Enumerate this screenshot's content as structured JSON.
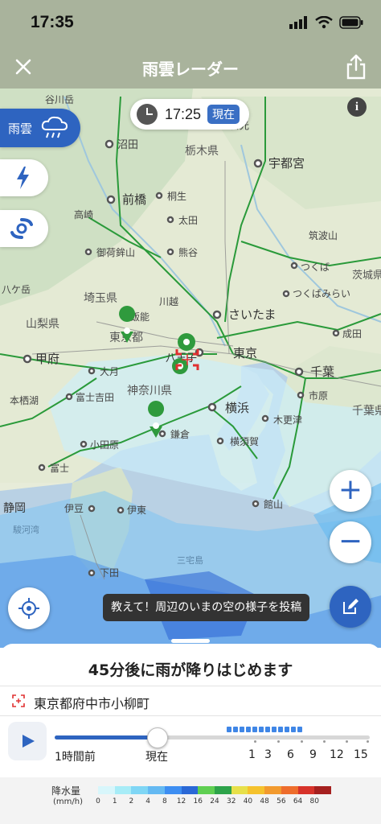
{
  "status_bar": {
    "time": "17:35"
  },
  "nav": {
    "title": "雨雲レーダー"
  },
  "map": {
    "time": "17:25",
    "now_badge": "現在",
    "layers": {
      "rain_label": "雨雲"
    },
    "place_labels": [
      "谷川岳",
      "日光",
      "沼田",
      "栃木県",
      "宇都宮",
      "前橋",
      "桐生",
      "高崎",
      "太田",
      "筑波山",
      "御荷鉾山",
      "熊谷",
      "つくば",
      "つくばみらい",
      "茨城県",
      "八ケ岳",
      "埼玉県",
      "川越",
      "飯能",
      "さいたま",
      "成田",
      "山梨県",
      "東京都",
      "甲府",
      "八王子",
      "東京",
      "千葉",
      "大月",
      "神奈川県",
      "市原",
      "本栖湖",
      "富士吉田",
      "横浜",
      "木更津",
      "千葉県",
      "鎌倉",
      "横須賀",
      "小田原",
      "富士",
      "静岡",
      "伊豆",
      "伊東",
      "館山",
      "駿河湾",
      "三宅島",
      "下田"
    ],
    "post_tip": "教えて！周辺のいまの空の様子を投稿"
  },
  "sheet": {
    "forecast": "45分後に雨が降りはじめます",
    "location": "東京都府中市小柳町",
    "timeline_labels": {
      "past": "1時間前",
      "now": "現在",
      "h1": "1",
      "h3": "3",
      "h6": "6",
      "h9": "9",
      "h12": "12",
      "h15": "15"
    }
  },
  "legend": {
    "title": "降水量",
    "unit": "(mm/h)",
    "values": [
      "0",
      "1",
      "2",
      "4",
      "8",
      "12",
      "16",
      "24",
      "32",
      "40",
      "48",
      "56",
      "64",
      "80"
    ],
    "colors": [
      "#d8f6fb",
      "#a7ecf7",
      "#7fd6f5",
      "#64b9f2",
      "#3d8ef2",
      "#2a68d6",
      "#5fcf52",
      "#2da34a",
      "#e7e04a",
      "#f5c22d",
      "#f29a2e",
      "#ee6d2c",
      "#d7322a",
      "#a5201f"
    ]
  },
  "colors": {
    "accent": "#2e64c0",
    "header": "#a9b39c"
  }
}
